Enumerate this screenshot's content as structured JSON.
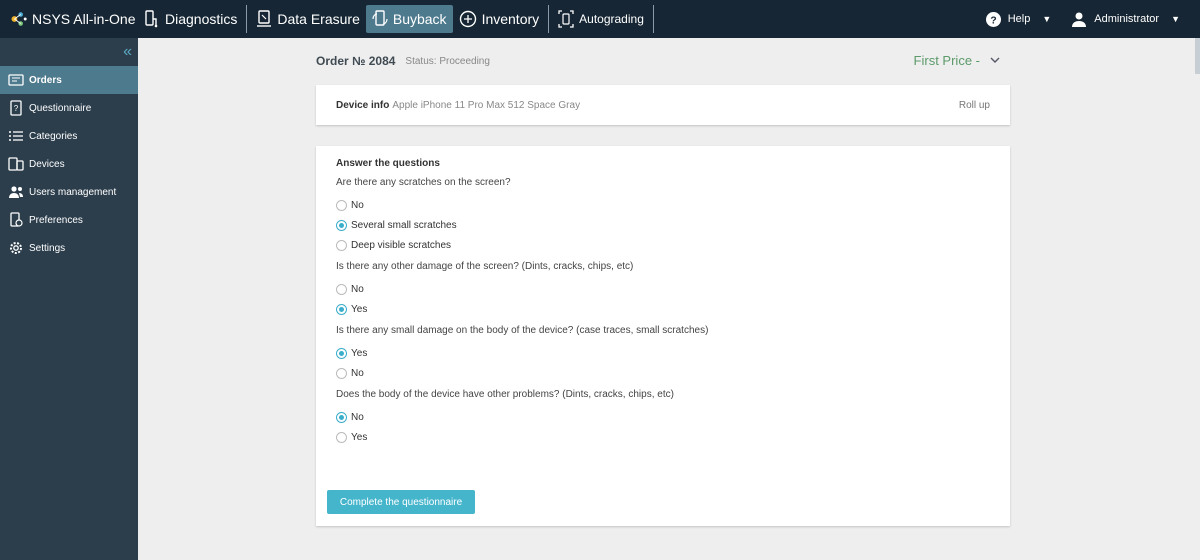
{
  "app": {
    "brand_prefix": "NSYS",
    "brand_suffix": " All-in-One"
  },
  "topnav": [
    {
      "label": "Diagnostics",
      "icon": "diagnostics-icon"
    },
    {
      "label": "Data Erasure",
      "icon": "data-erasure-icon"
    },
    {
      "label": "Buyback",
      "icon": "buyback-icon",
      "active": true
    },
    {
      "label": "Inventory",
      "icon": "inventory-icon"
    },
    {
      "label": "Autograding",
      "icon": "autograding-icon"
    }
  ],
  "topright": {
    "help": "Help",
    "user": "Administrator"
  },
  "sidebar": {
    "items": [
      {
        "label": "Orders",
        "icon": "orders-icon",
        "active": true
      },
      {
        "label": "Questionnaire",
        "icon": "questionnaire-icon"
      },
      {
        "label": "Categories",
        "icon": "list-icon"
      },
      {
        "label": "Devices",
        "icon": "devices-icon"
      },
      {
        "label": "Users management",
        "icon": "users-icon"
      },
      {
        "label": "Preferences",
        "icon": "preferences-icon"
      },
      {
        "label": "Settings",
        "icon": "gear-icon"
      }
    ]
  },
  "order": {
    "title": "Order № 2084",
    "status": "Status: Proceeding",
    "price_option": "First Price -"
  },
  "device": {
    "label": "Device info",
    "value": "Apple iPhone 11 Pro Max 512 Space Gray",
    "rollup": "Roll up"
  },
  "questionnaire": {
    "heading": "Answer the questions",
    "questions": [
      {
        "text": "Are there any scratches on the screen?",
        "options": [
          {
            "label": "No",
            "checked": false
          },
          {
            "label": "Several small scratches",
            "checked": true
          },
          {
            "label": "Deep visible scratches",
            "checked": false
          }
        ]
      },
      {
        "text": "Is there any other damage of the screen? (Dints, cracks, chips, etc)",
        "options": [
          {
            "label": "No",
            "checked": false
          },
          {
            "label": "Yes",
            "checked": true
          }
        ]
      },
      {
        "text": "Is there any small damage on the body of the device? (case traces, small scratches)",
        "options": [
          {
            "label": "Yes",
            "checked": true
          },
          {
            "label": "No",
            "checked": false
          }
        ]
      },
      {
        "text": "Does the body of the device have other problems? (Dints, cracks, chips, etc)",
        "options": [
          {
            "label": "No",
            "checked": true
          },
          {
            "label": "Yes",
            "checked": false
          }
        ]
      }
    ],
    "submit_label": "Complete the questionnaire"
  },
  "colors": {
    "topbar": "#162634",
    "sidebar": "#2c3e4c",
    "active": "#4e7a8e",
    "accent": "#45b5cc",
    "price": "#5b9a6a"
  }
}
